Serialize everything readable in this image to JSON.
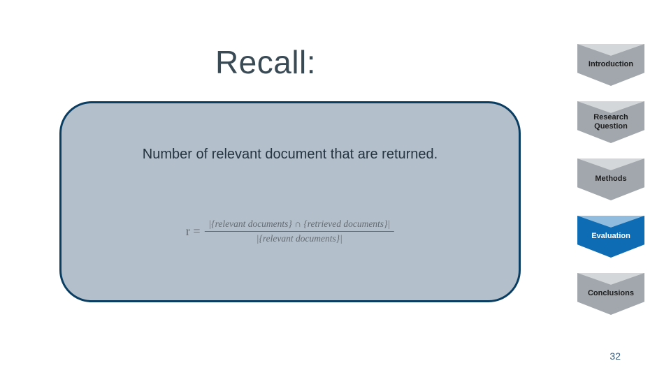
{
  "title": "Recall:",
  "bubble": {
    "text": "Number of relevant document that are returned.",
    "formula_lhs": "r =",
    "formula_num": "|{relevant documents} ∩ {retrieved documents}|",
    "formula_den": "|{relevant documents}|"
  },
  "steps": [
    {
      "label": "Introduction",
      "active": false
    },
    {
      "label": "Research Question",
      "active": false
    },
    {
      "label": "Methods",
      "active": false
    },
    {
      "label": "Evaluation",
      "active": true
    },
    {
      "label": "Conclusions",
      "active": false
    }
  ],
  "colors": {
    "step_inactive": "#a1a7ac",
    "step_active": "#0d6cb4"
  },
  "page_number": "32"
}
